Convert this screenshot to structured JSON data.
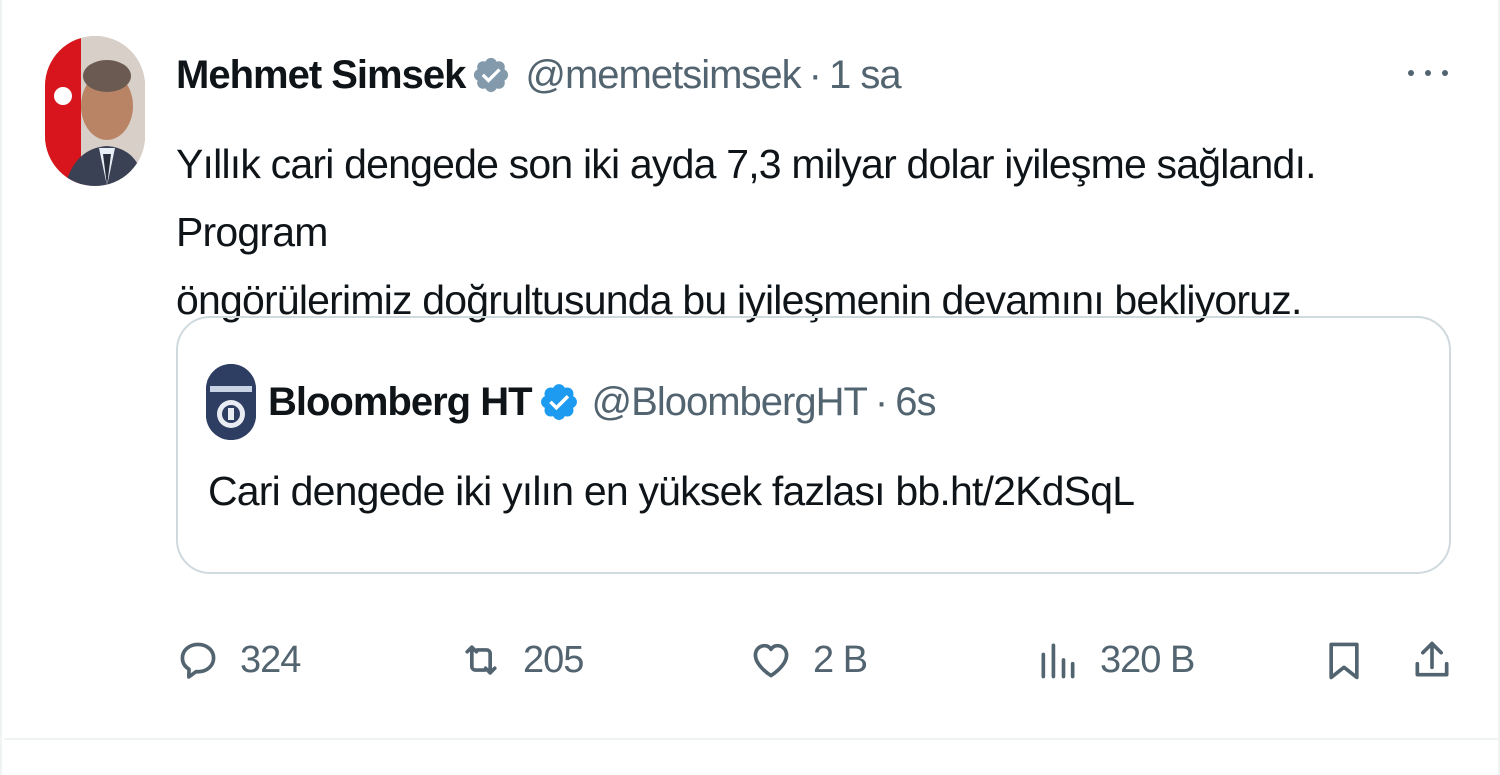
{
  "tweet": {
    "author_name": "Mehmet Simsek",
    "handle": "@memetsimsek",
    "separator": "·",
    "time": "1 sa",
    "text_line1": "Yıllık cari dengede son iki ayda 7,3 milyar dolar iyileşme sağlandı. Program",
    "text_line2": "öngörülerimiz doğrultusunda bu iyileşmenin devamını bekliyoruz.",
    "verified_color": "#829aab",
    "avatar_icon": "person-portrait-icon"
  },
  "quote": {
    "author_name": "Bloomberg HT",
    "handle": "@BloombergHT",
    "separator": "·",
    "time": "6s",
    "text": "Cari dengede iki yılın en yüksek fazlası bb.ht/2KdSqL",
    "verified_color": "#1d9bf0",
    "avatar_icon": "bloomberg-ht-logo-icon"
  },
  "actions": {
    "replies": "324",
    "reposts": "205",
    "likes": "2 B",
    "views": "320 B"
  },
  "colors": {
    "text_primary": "#0f1419",
    "text_secondary": "#536471",
    "border": "#cfd9de",
    "divider": "#eff3f4"
  }
}
